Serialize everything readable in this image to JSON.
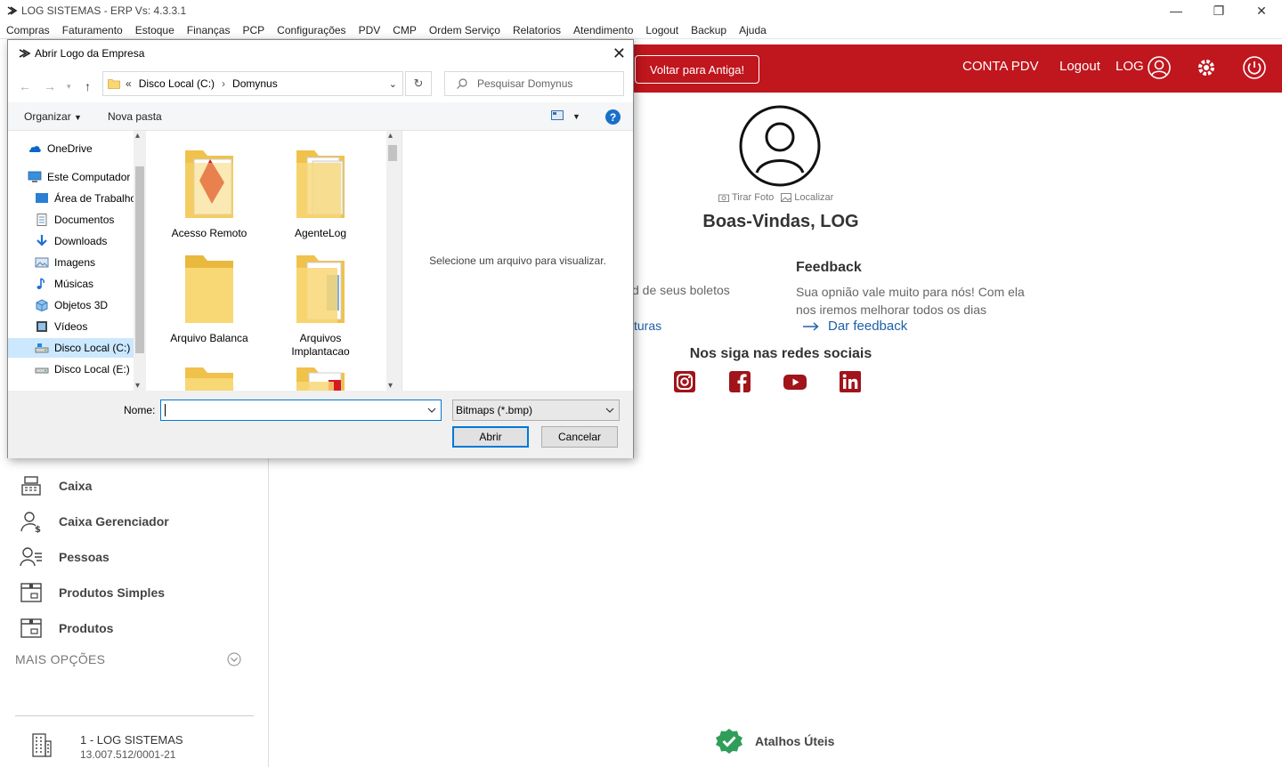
{
  "window": {
    "title": "LOG SISTEMAS - ERP Vs: 4.3.3.1"
  },
  "menu": [
    "Compras",
    "Faturamento",
    "Estoque",
    "Finanças",
    "PCP",
    "Configurações",
    "PDV",
    "CMP",
    "Ordem Serviço",
    "Relatorios",
    "Atendimento",
    "Logout",
    "Backup",
    "Ajuda"
  ],
  "header": {
    "old_button": "Voltar para Antiga!",
    "conta_pdv": "CONTA PDV",
    "logout": "Logout",
    "user": "LOG"
  },
  "main": {
    "take_photo": "Tirar Foto",
    "locate": "Localizar",
    "welcome": "Boas-Vindas, LOG",
    "boletos_text": "d de seus boletos",
    "faturas_link": "turas",
    "feedback_title": "Feedback",
    "feedback_text": "Sua opnião vale muito para nós! Com ela nos iremos melhorar todos os dias",
    "feedback_link": "Dar feedback",
    "social_title": "Nos siga nas redes sociais",
    "shortcuts": "Atalhos Úteis"
  },
  "sidebar": {
    "items": [
      {
        "label": "Caixa"
      },
      {
        "label": "Caixa Gerenciador"
      },
      {
        "label": "Pessoas"
      },
      {
        "label": "Produtos Simples"
      },
      {
        "label": "Produtos"
      }
    ],
    "more": "MAIS OPÇÕES",
    "company_name": "1 - LOG SISTEMAS",
    "company_cnpj": "13.007.512/0001-21"
  },
  "dialog": {
    "title": "Abrir Logo da Empresa",
    "breadcrumb_prefix": "«",
    "breadcrumb": [
      "Disco Local (C:)",
      "Domynus"
    ],
    "search_placeholder": "Pesquisar Domynus",
    "organize": "Organizar",
    "new_folder": "Nova pasta",
    "nav_items": [
      {
        "label": "OneDrive",
        "icon": "cloud-icon"
      },
      {
        "label": "Este Computador",
        "icon": "computer-icon"
      },
      {
        "label": "Área de Trabalho",
        "icon": "desktop-icon"
      },
      {
        "label": "Documentos",
        "icon": "documents-icon"
      },
      {
        "label": "Downloads",
        "icon": "download-icon"
      },
      {
        "label": "Imagens",
        "icon": "pictures-icon"
      },
      {
        "label": "Músicas",
        "icon": "music-icon"
      },
      {
        "label": "Objetos 3D",
        "icon": "cube-icon"
      },
      {
        "label": "Vídeos",
        "icon": "video-icon"
      },
      {
        "label": "Disco Local (C:)",
        "icon": "drive-icon"
      },
      {
        "label": "Disco Local (E:)",
        "icon": "drive-icon"
      }
    ],
    "files": [
      {
        "label": "Acesso Remoto"
      },
      {
        "label": "AgenteLog"
      },
      {
        "label": "Arquivo Balanca"
      },
      {
        "label": "Arquivos Implantacao"
      }
    ],
    "preview_text": "Selecione um arquivo para visualizar.",
    "name_label": "Nome:",
    "name_value": "",
    "filter": "Bitmaps (*.bmp)",
    "open": "Abrir",
    "cancel": "Cancelar"
  }
}
